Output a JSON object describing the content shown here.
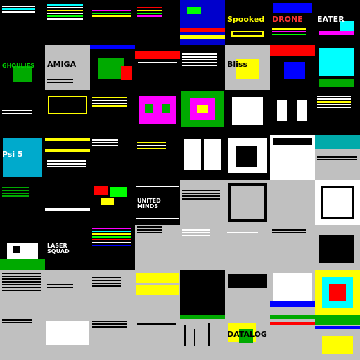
{
  "gallery": {
    "tiles": [
      {
        "label": "",
        "bg": "#000000"
      },
      {
        "label": "",
        "bg": "#000000"
      },
      {
        "label": "",
        "bg": "#000000"
      },
      {
        "label": "",
        "bg": "#000000"
      },
      {
        "label": "",
        "bg": "#0000cc"
      },
      {
        "label": "Spooked",
        "bg": "#000000",
        "fg": "#ffff00"
      },
      {
        "label": "DRONE",
        "bg": "#000000",
        "fg": "#ff3333"
      },
      {
        "label": "EATER",
        "bg": "#000000",
        "fg": "#ffffff"
      },
      {
        "label": "GHOULIES",
        "bg": "#000000",
        "fg": "#00cc00"
      },
      {
        "label": "AMIGA",
        "bg": "#c0c0c0",
        "fg": "#000000"
      },
      {
        "label": "",
        "bg": "#000000"
      },
      {
        "label": "",
        "bg": "#000000"
      },
      {
        "label": "",
        "bg": "#000000"
      },
      {
        "label": "Bliss",
        "bg": "#c0c0c0",
        "fg": "#000000"
      },
      {
        "label": "",
        "bg": "#000000"
      },
      {
        "label": "",
        "bg": "#000000"
      },
      {
        "label": "",
        "bg": "#000000"
      },
      {
        "label": "",
        "bg": "#000000"
      },
      {
        "label": "",
        "bg": "#000000"
      },
      {
        "label": "",
        "bg": "#000000"
      },
      {
        "label": "",
        "bg": "#000000"
      },
      {
        "label": "",
        "bg": "#000000"
      },
      {
        "label": "",
        "bg": "#000000"
      },
      {
        "label": "",
        "bg": "#000000"
      },
      {
        "label": "Psi 5",
        "bg": "#000000",
        "fg": "#ffffff"
      },
      {
        "label": "",
        "bg": "#000000"
      },
      {
        "label": "",
        "bg": "#000000"
      },
      {
        "label": "",
        "bg": "#000000"
      },
      {
        "label": "",
        "bg": "#000000"
      },
      {
        "label": "",
        "bg": "#000000"
      },
      {
        "label": "",
        "bg": "#ffffff"
      },
      {
        "label": "",
        "bg": "#c0c0c0"
      },
      {
        "label": "",
        "bg": "#000000"
      },
      {
        "label": "",
        "bg": "#000000"
      },
      {
        "label": "",
        "bg": "#000000"
      },
      {
        "label": "UNITED MINDS",
        "bg": "#000000",
        "fg": "#ffffff"
      },
      {
        "label": "",
        "bg": "#c0c0c0"
      },
      {
        "label": "",
        "bg": "#c0c0c0"
      },
      {
        "label": "",
        "bg": "#c0c0c0"
      },
      {
        "label": "",
        "bg": "#ffffff"
      },
      {
        "label": "",
        "bg": "#000000"
      },
      {
        "label": "LASER SQUAD",
        "bg": "#000000",
        "fg": "#ffffff"
      },
      {
        "label": "",
        "bg": "#000000"
      },
      {
        "label": "",
        "bg": "#c0c0c0"
      },
      {
        "label": "",
        "bg": "#c0c0c0"
      },
      {
        "label": "",
        "bg": "#c0c0c0"
      },
      {
        "label": "",
        "bg": "#c0c0c0"
      },
      {
        "label": "",
        "bg": "#c0c0c0"
      },
      {
        "label": "",
        "bg": "#c0c0c0"
      },
      {
        "label": "",
        "bg": "#c0c0c0"
      },
      {
        "label": "",
        "bg": "#c0c0c0"
      },
      {
        "label": "",
        "bg": "#c0c0c0"
      },
      {
        "label": "",
        "bg": "#000000"
      },
      {
        "label": "",
        "bg": "#c0c0c0"
      },
      {
        "label": "",
        "bg": "#c0c0c0"
      },
      {
        "label": "",
        "bg": "#000000"
      },
      {
        "label": "",
        "bg": "#c0c0c0"
      },
      {
        "label": "",
        "bg": "#c0c0c0"
      },
      {
        "label": "",
        "bg": "#c0c0c0"
      },
      {
        "label": "",
        "bg": "#c0c0c0"
      },
      {
        "label": "",
        "bg": "#c0c0c0"
      },
      {
        "label": "DATALOG",
        "bg": "#c0c0c0",
        "fg": "#000000"
      },
      {
        "label": "",
        "bg": "#c0c0c0"
      },
      {
        "label": "",
        "bg": "#c0c0c0"
      }
    ]
  }
}
